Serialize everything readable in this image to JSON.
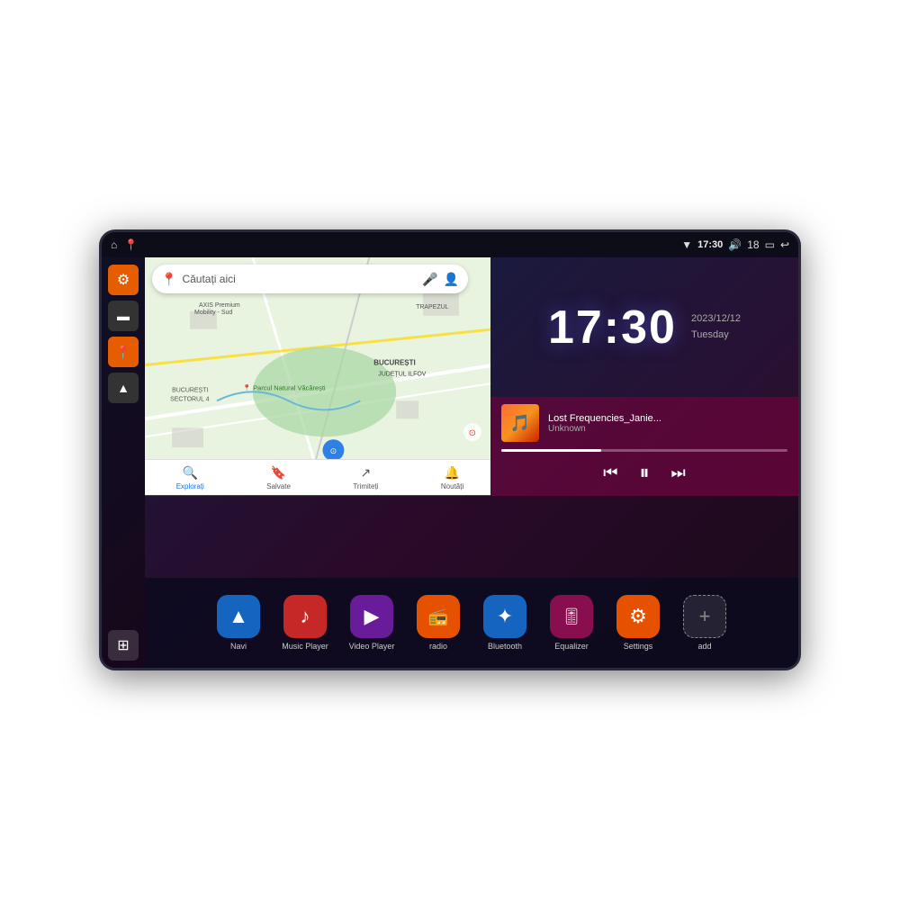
{
  "device": {
    "status_bar": {
      "wifi_icon": "▼",
      "time": "17:30",
      "volume_icon": "🔊",
      "battery_level": "18",
      "battery_icon": "🔋",
      "back_icon": "↩"
    },
    "sidebar": {
      "settings_icon": "⚙",
      "folder_icon": "▬",
      "map_icon": "📍",
      "nav_icon": "▶",
      "grid_icon": "⊞"
    },
    "map": {
      "search_placeholder": "Căutați aici",
      "nav_items": [
        {
          "label": "Explorați",
          "icon": "📍",
          "active": true
        },
        {
          "label": "Salvate",
          "icon": "🔖",
          "active": false
        },
        {
          "label": "Trimiteți",
          "icon": "↗",
          "active": false
        },
        {
          "label": "Noutăți",
          "icon": "🔔",
          "active": false
        }
      ]
    },
    "clock": {
      "time": "17:30",
      "date": "2023/12/12",
      "day": "Tuesday"
    },
    "music": {
      "title": "Lost Frequencies_Janie...",
      "artist": "Unknown",
      "progress": 35
    },
    "apps": [
      {
        "id": "navi",
        "label": "Navi",
        "icon": "▲",
        "color_class": "icon-navi"
      },
      {
        "id": "music",
        "label": "Music Player",
        "icon": "♪",
        "color_class": "icon-music"
      },
      {
        "id": "video",
        "label": "Video Player",
        "icon": "▶",
        "color_class": "icon-video"
      },
      {
        "id": "radio",
        "label": "radio",
        "icon": "📻",
        "color_class": "icon-radio"
      },
      {
        "id": "bluetooth",
        "label": "Bluetooth",
        "icon": "✦",
        "color_class": "icon-bt"
      },
      {
        "id": "equalizer",
        "label": "Equalizer",
        "icon": "🎚",
        "color_class": "icon-eq"
      },
      {
        "id": "settings",
        "label": "Settings",
        "icon": "⚙",
        "color_class": "icon-settings"
      },
      {
        "id": "add",
        "label": "add",
        "icon": "+",
        "color_class": "icon-add"
      }
    ]
  }
}
